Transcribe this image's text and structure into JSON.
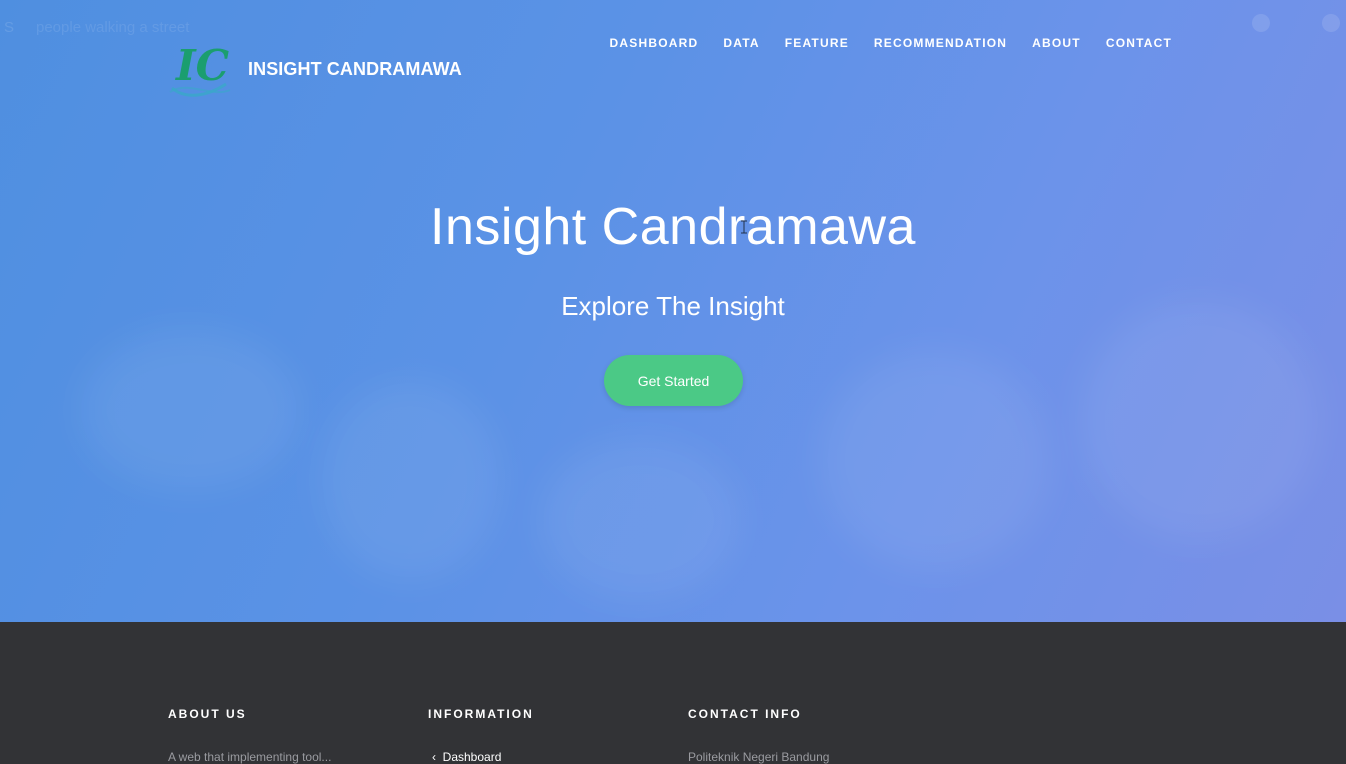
{
  "video_overlay": {
    "letter": "S",
    "title": "people walking a street"
  },
  "brand": {
    "logo_text": "IC",
    "name": "INSIGHT CANDRAMAWA"
  },
  "nav": {
    "items": [
      "DASHBOARD",
      "DATA",
      "FEATURE",
      "RECOMMENDATION",
      "ABOUT",
      "CONTACT"
    ]
  },
  "hero": {
    "title": "Insight Candramawa",
    "subtitle": "Explore The Insight",
    "cta": "Get Started"
  },
  "footer": {
    "about": {
      "heading": "ABOUT US",
      "text": "A web that implementing tool..."
    },
    "information": {
      "heading": "INFORMATION",
      "first_link": "Dashboard"
    },
    "contact": {
      "heading": "CONTACT INFO",
      "text": "Politeknik Negeri Bandung"
    }
  },
  "colors": {
    "hero_start": "#4f8fe0",
    "hero_end": "#7a8fe6",
    "cta": "#4bc986",
    "footer": "#323336",
    "logo_green": "#1b9e6f"
  }
}
